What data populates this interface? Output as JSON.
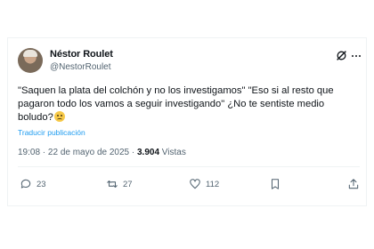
{
  "post": {
    "author_name": "Néstor Roulet",
    "author_handle": "@NestorRoulet",
    "text": "\"Saquen la plata del colchón y no los investigamos\" \"Eso si al resto que pagaron todo los vamos a seguir investigando\" ¿No te sentiste medio boludo?",
    "translate_label": "Traducir publicación",
    "time": "19:08 · 22 de mayo de 2025 · ",
    "views_count": "3.904",
    "views_label": " Vistas"
  },
  "actions": {
    "replies": "23",
    "reposts": "27",
    "likes": "112"
  },
  "icons": {
    "grok": "grok-icon",
    "more": "more-icon",
    "reply": "reply-icon",
    "repost": "repost-icon",
    "like": "heart-icon",
    "bookmark": "bookmark-icon",
    "share": "share-icon",
    "emoji": "worried-face-emoji"
  },
  "colors": {
    "text": "#0f1419",
    "secondary": "#536471",
    "link": "#1d9bf0",
    "border": "#eff3f4"
  }
}
